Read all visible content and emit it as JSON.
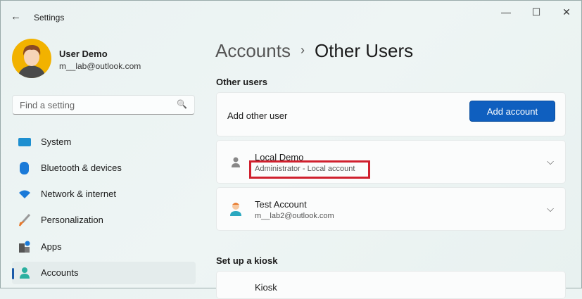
{
  "window": {
    "title": "Settings",
    "back": "←",
    "minimize": "—",
    "maximize": "☐",
    "close": "✕"
  },
  "user": {
    "name": "User Demo",
    "email": "m__lab@outlook.com"
  },
  "search": {
    "placeholder": "Find a setting",
    "icon": "🔍"
  },
  "nav": [
    {
      "label": "System"
    },
    {
      "label": "Bluetooth & devices"
    },
    {
      "label": "Network & internet"
    },
    {
      "label": "Personalization"
    },
    {
      "label": "Apps"
    },
    {
      "label": "Accounts"
    }
  ],
  "breadcrumb": {
    "parent": "Accounts",
    "sep": "›",
    "current": "Other Users"
  },
  "other_users": {
    "heading": "Other users",
    "add_label": "Add other user",
    "add_button": "Add account",
    "users": [
      {
        "name": "Local Demo",
        "detail": "Administrator - Local account"
      },
      {
        "name": "Test Account",
        "detail": "m__lab2@outlook.com"
      }
    ]
  },
  "kiosk": {
    "heading": "Set up a kiosk",
    "label": "Kiosk"
  },
  "chevron": "⌵"
}
